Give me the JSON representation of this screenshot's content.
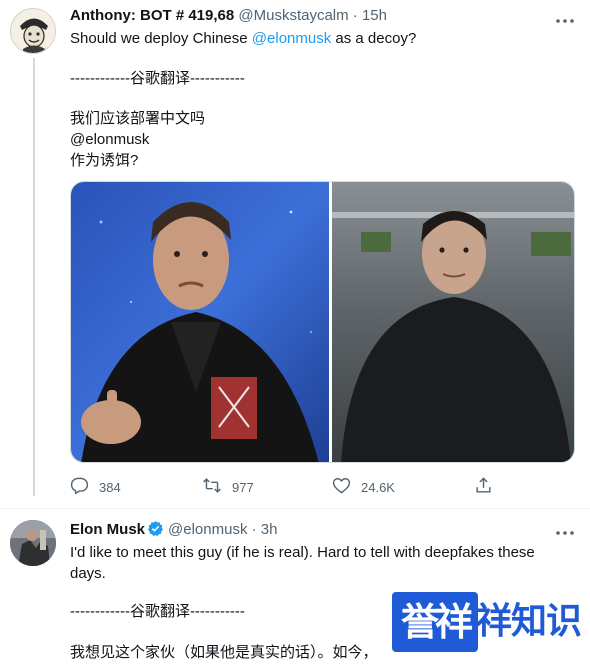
{
  "tweet1": {
    "display_name": "Anthony: BOT # 419,68",
    "handle": "@Muskstaycalm",
    "separator": "·",
    "time": "15h",
    "text_before_mention": "Should we deploy Chinese ",
    "mention": "@elonmusk",
    "text_after_mention": " as a decoy?",
    "translate_divider": "------------谷歌翻译-----------",
    "translation_line1": "我们应该部署中文吗",
    "translation_line2": "@elonmusk",
    "translation_line3": " 作为诱饵?",
    "actions": {
      "reply_count": "384",
      "retweet_count": "977",
      "like_count": "24.6K"
    }
  },
  "tweet2": {
    "display_name": "Elon Musk",
    "handle": "@elonmusk",
    "separator": "·",
    "time": "3h",
    "text_line1": "I'd like to meet this guy (if he is real). Hard to tell with deepfakes these",
    "text_line2": "days.",
    "translate_divider": "------------谷歌翻译-----------",
    "translation_line1": "我想见这个家伙（如果他是真实的话）。如今，"
  },
  "watermark": {
    "badge": "誉祥",
    "text": "祥知识"
  },
  "colors": {
    "link": "#1d9bf0",
    "secondary_text": "#536471",
    "verified": "#1d9bf0",
    "watermark": "#1f5bd6"
  },
  "icons": [
    "more-icon",
    "reply-icon",
    "retweet-icon",
    "like-icon",
    "share-icon",
    "verified-badge-icon"
  ]
}
